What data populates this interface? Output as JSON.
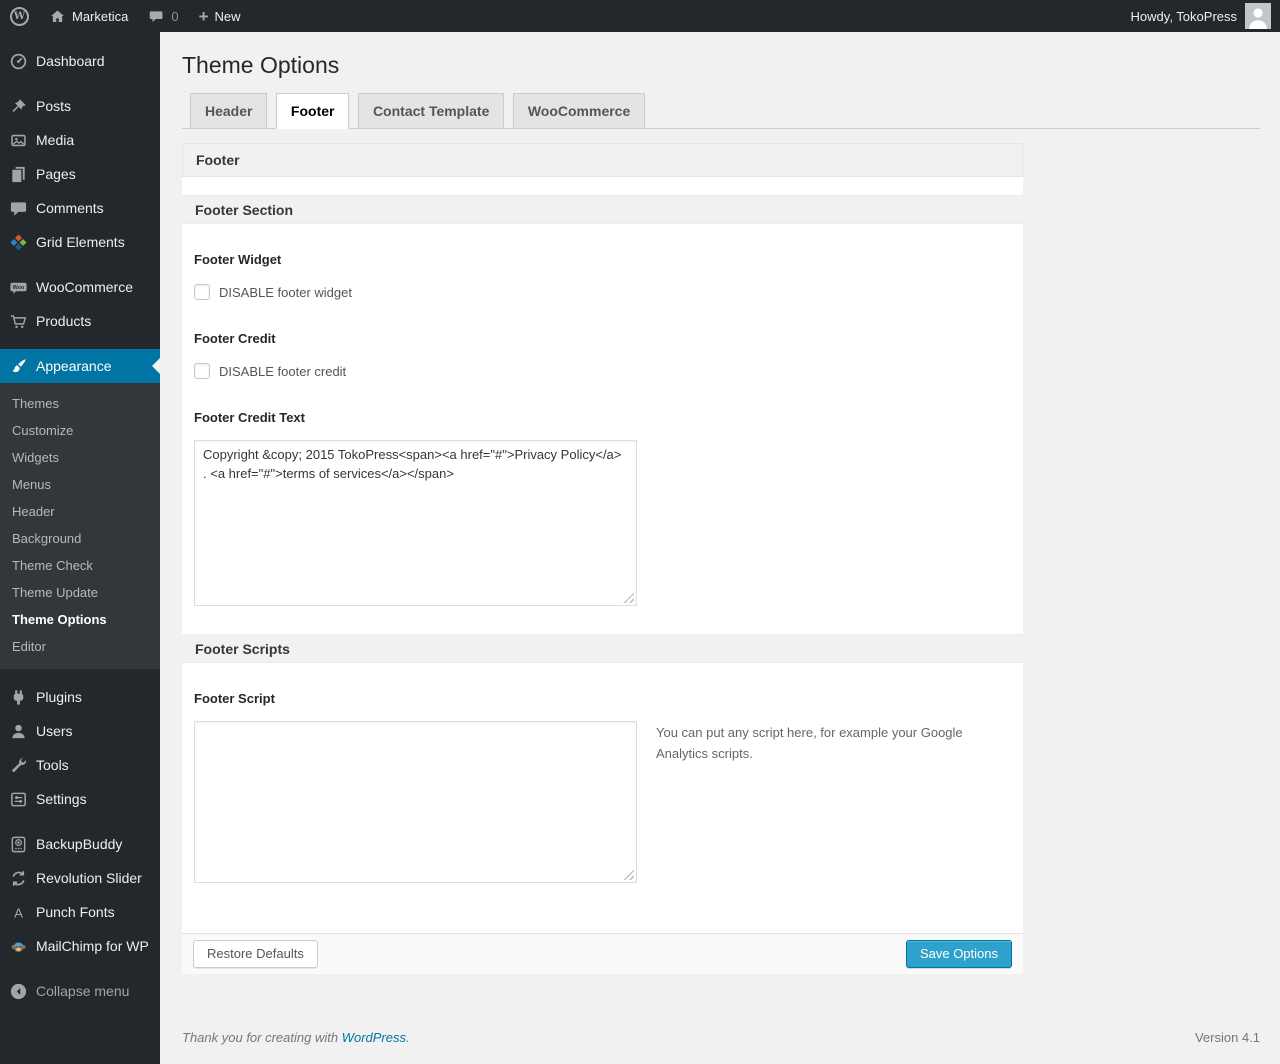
{
  "admin_bar": {
    "wp_logo_letter": "W",
    "site_name": "Marketica",
    "comments_count": "0",
    "new_label": "New",
    "howdy_text": "Howdy, TokoPress"
  },
  "sidebar": {
    "items": [
      {
        "label": "Dashboard",
        "icon": "dashboard-icon"
      },
      {
        "label": "Posts",
        "icon": "pushpin-icon"
      },
      {
        "label": "Media",
        "icon": "media-icon"
      },
      {
        "label": "Pages",
        "icon": "pages-icon"
      },
      {
        "label": "Comments",
        "icon": "comment-icon"
      },
      {
        "label": "Grid Elements",
        "icon": "grid-elements-icon"
      },
      {
        "label": "WooCommerce",
        "icon": "woocommerce-icon"
      },
      {
        "label": "Products",
        "icon": "cart-icon"
      },
      {
        "label": "Appearance",
        "icon": "brush-icon",
        "active": true
      },
      {
        "label": "Plugins",
        "icon": "plugin-icon"
      },
      {
        "label": "Users",
        "icon": "user-icon"
      },
      {
        "label": "Tools",
        "icon": "wrench-icon"
      },
      {
        "label": "Settings",
        "icon": "settings-icon"
      },
      {
        "label": "BackupBuddy",
        "icon": "backup-drive-icon"
      },
      {
        "label": "Revolution Slider",
        "icon": "refresh-icon"
      },
      {
        "label": "Punch Fonts",
        "icon": "letter-a-icon"
      },
      {
        "label": "MailChimp for WP",
        "icon": "mailchimp-icon"
      }
    ],
    "submenu": [
      "Themes",
      "Customize",
      "Widgets",
      "Menus",
      "Header",
      "Background",
      "Theme Check",
      "Theme Update",
      "Theme Options",
      "Editor"
    ],
    "current_submenu_item": "Theme Options",
    "collapse_label": "Collapse menu"
  },
  "page": {
    "title": "Theme Options",
    "tabs": [
      {
        "label": "Header"
      },
      {
        "label": "Footer"
      },
      {
        "label": "Contact Template"
      },
      {
        "label": "WooCommerce"
      }
    ],
    "active_tab": "Footer"
  },
  "panel": {
    "header_title": "Footer",
    "section1_title": "Footer Section",
    "footer_widget": {
      "label": "Footer Widget",
      "checkbox_label": "DISABLE footer widget",
      "checked": false
    },
    "footer_credit": {
      "label": "Footer Credit",
      "checkbox_label": "DISABLE footer credit",
      "checked": false
    },
    "footer_credit_text": {
      "label": "Footer Credit Text",
      "value": "Copyright &copy; 2015 TokoPress<span><a href=\"#\">Privacy Policy</a> . <a href=\"#\">terms of services</a></span>"
    },
    "section2_title": "Footer Scripts",
    "footer_script": {
      "label": "Footer Script",
      "value": "",
      "help": "You can put any script here, for example your Google Analytics scripts."
    },
    "restore_button_label": "Restore Defaults",
    "save_button_label": "Save Options"
  },
  "page_footer": {
    "thanks_prefix": "Thank you for creating with ",
    "link_label": "WordPress",
    "thanks_suffix": ".",
    "version": "Version 4.1"
  },
  "colors": {
    "admin_dark": "#23282d",
    "submenu_bg": "#32373c",
    "accent_blue": "#0074a2",
    "primary_button": "#2ea2cc",
    "page_bg": "#f1f1f1"
  }
}
